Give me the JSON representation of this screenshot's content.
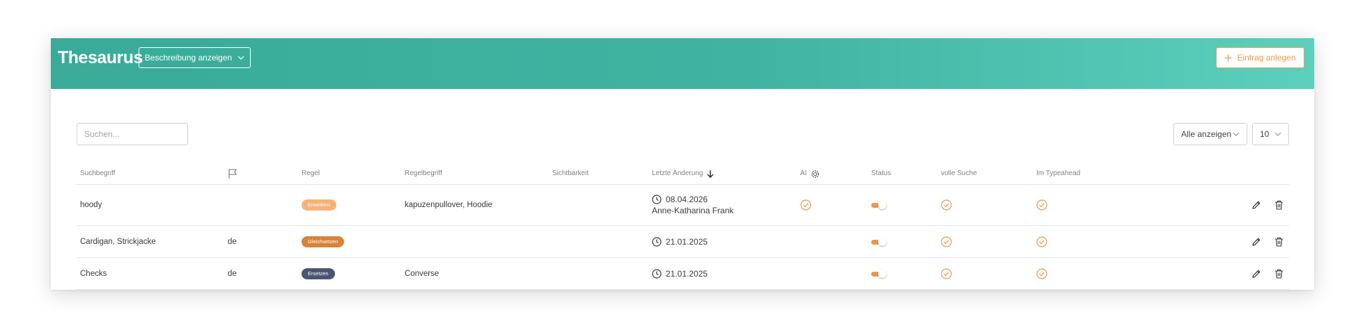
{
  "header": {
    "title": "Thesaurus",
    "description_toggle_label": "Beschreibung anzeigen",
    "new_entry_label": "Eintrag anlegen",
    "colors": {
      "gradient_start": "#39ab98",
      "gradient_end": "#5ccfbd",
      "accent": "#f0954a"
    }
  },
  "toolbar": {
    "search_placeholder": "Suchen...",
    "search_value": "",
    "filter_value": "Alle anzeigen",
    "page_size_value": "10"
  },
  "table": {
    "columns": {
      "suchbegriff": "Suchbegriff",
      "flag_icon": "flag-icon",
      "regel": "Regel",
      "regelbegriff": "Regelbegriff",
      "sichtbarkeit": "Sichtbarkeit",
      "letzte_aenderung": "Letzte Änderung",
      "sort_icon": "arrow-down-icon",
      "ai": "AI",
      "ai_icon": "gear-icon",
      "status": "Status",
      "volle_suche": "volle Suche",
      "im_typeahead": "Im Typeahead"
    },
    "rows": [
      {
        "suchbegriff": "hoody",
        "sprache": "",
        "regel": "Erweitern",
        "regel_color": "#f7b27a",
        "regelbegriff": "kapuzenpullover, Hoodie",
        "datum": "08.04.2026",
        "autor": "Anne-Katharina Frank",
        "ai_checked": true,
        "status_on": true,
        "volle_suche": true,
        "im_typeahead": true
      },
      {
        "suchbegriff": "Cardigan, Strickjacke",
        "sprache": "de",
        "regel": "Gleichsetzen",
        "regel_color": "#d9823a",
        "regelbegriff": "",
        "datum": "21.01.2025",
        "autor": "",
        "ai_checked": false,
        "status_on": true,
        "volle_suche": true,
        "im_typeahead": true
      },
      {
        "suchbegriff": "Checks",
        "sprache": "de",
        "regel": "Ersetzen",
        "regel_color": "#4c5570",
        "regelbegriff": "Converse",
        "datum": "21.01.2025",
        "autor": "",
        "ai_checked": false,
        "status_on": true,
        "volle_suche": true,
        "im_typeahead": true
      }
    ]
  },
  "icons": {
    "plus": "plus-icon",
    "chevron": "chevron-down-icon",
    "clock": "clock-icon",
    "check": "check-circle-icon",
    "edit": "pencil-icon",
    "delete": "trash-icon"
  }
}
